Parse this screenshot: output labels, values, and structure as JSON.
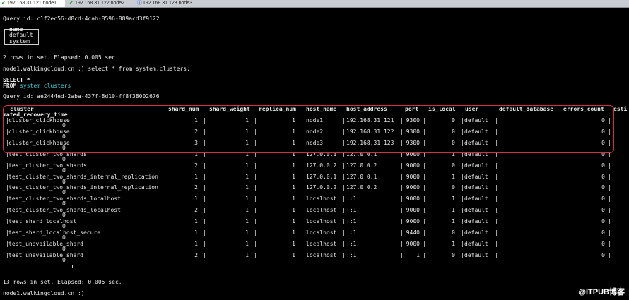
{
  "tabs": [
    {
      "label": "192.168.31.121 node1",
      "active": true
    },
    {
      "label": "192.168.31.122 node2",
      "active": false
    },
    {
      "label": "192.168.31.123 node3",
      "active": false
    }
  ],
  "top": {
    "query_id_1": "Query id: c1f2ec56-d8cd-4cab-8596-889acd3f9122",
    "name_header": "name",
    "name_rows": [
      "default",
      "system"
    ],
    "rows_info_1": "2 rows in set. Elapsed: 0.005 sec.",
    "prompt_1": "node1.walkingcloud.cn :) select * from system.clusters;",
    "select_kw": "SELECT *",
    "from_kw": "FROM",
    "from_table": "system.clusters",
    "query_id_2": "Query id: ae2444ed-2aba-437f-8d10-ff8f38002676"
  },
  "table": {
    "headers": [
      "cluster",
      "shard_num",
      "shard_weight",
      "replica_num",
      "host_name",
      "host_address",
      "port",
      "is_local",
      "user",
      "default_database",
      "errors_count",
      "esti"
    ],
    "wrap_header": "mated_recovery_time",
    "rows": [
      {
        "cluster": "cluster_clickhouse",
        "shard_num": "1",
        "shard_weight": "1",
        "replica_num": "1",
        "host_name": "node1",
        "host_address": "192.168.31.121",
        "port": "9300",
        "is_local": "0",
        "user": "default",
        "errors_count": "0",
        "wrap": "0"
      },
      {
        "cluster": "cluster_clickhouse",
        "shard_num": "2",
        "shard_weight": "1",
        "replica_num": "1",
        "host_name": "node2",
        "host_address": "192.168.31.122",
        "port": "9300",
        "is_local": "0",
        "user": "default",
        "errors_count": "0",
        "wrap": "0"
      },
      {
        "cluster": "cluster_clickhouse",
        "shard_num": "3",
        "shard_weight": "1",
        "replica_num": "1",
        "host_name": "node3",
        "host_address": "192.168.31.123",
        "port": "9300",
        "is_local": "0",
        "user": "default",
        "errors_count": "0",
        "wrap": "0"
      },
      {
        "cluster": "test_cluster_two_shards",
        "shard_num": "1",
        "shard_weight": "1",
        "replica_num": "1",
        "host_name": "127.0.0.1",
        "host_address": "127.0.0.1",
        "port": "9000",
        "is_local": "1",
        "user": "default",
        "errors_count": "0",
        "wrap": "0"
      },
      {
        "cluster": "test_cluster_two_shards",
        "shard_num": "2",
        "shard_weight": "1",
        "replica_num": "1",
        "host_name": "127.0.0.2",
        "host_address": "127.0.0.2",
        "port": "9000",
        "is_local": "0",
        "user": "default",
        "errors_count": "0",
        "wrap": "0"
      },
      {
        "cluster": "test_cluster_two_shards_internal_replication",
        "shard_num": "1",
        "shard_weight": "1",
        "replica_num": "1",
        "host_name": "127.0.0.1",
        "host_address": "127.0.0.1",
        "port": "9000",
        "is_local": "1",
        "user": "default",
        "errors_count": "0",
        "wrap": "0"
      },
      {
        "cluster": "test_cluster_two_shards_internal_replication",
        "shard_num": "2",
        "shard_weight": "1",
        "replica_num": "1",
        "host_name": "127.0.0.2",
        "host_address": "127.0.0.2",
        "port": "9000",
        "is_local": "0",
        "user": "default",
        "errors_count": "0",
        "wrap": "0"
      },
      {
        "cluster": "test_cluster_two_shards_localhost",
        "shard_num": "1",
        "shard_weight": "1",
        "replica_num": "1",
        "host_name": "localhost",
        "host_address": "::1",
        "port": "9000",
        "is_local": "1",
        "user": "default",
        "errors_count": "0",
        "wrap": "0"
      },
      {
        "cluster": "test_cluster_two_shards_localhost",
        "shard_num": "2",
        "shard_weight": "1",
        "replica_num": "1",
        "host_name": "localhost",
        "host_address": "::1",
        "port": "9000",
        "is_local": "1",
        "user": "default",
        "errors_count": "0",
        "wrap": "0"
      },
      {
        "cluster": "test_shard_localhost",
        "shard_num": "1",
        "shard_weight": "1",
        "replica_num": "1",
        "host_name": "localhost",
        "host_address": "::1",
        "port": "9000",
        "is_local": "1",
        "user": "default",
        "errors_count": "0",
        "wrap": "0"
      },
      {
        "cluster": "test_shard_localhost_secure",
        "shard_num": "1",
        "shard_weight": "1",
        "replica_num": "1",
        "host_name": "localhost",
        "host_address": "::1",
        "port": "9440",
        "is_local": "0",
        "user": "default",
        "errors_count": "0",
        "wrap": "0"
      },
      {
        "cluster": "test_unavailable_shard",
        "shard_num": "1",
        "shard_weight": "1",
        "replica_num": "1",
        "host_name": "localhost",
        "host_address": "::1",
        "port": "9000",
        "is_local": "1",
        "user": "default",
        "errors_count": "0",
        "wrap": "0"
      },
      {
        "cluster": "test_unavailable_shard",
        "shard_num": "2",
        "shard_weight": "1",
        "replica_num": "1",
        "host_name": "localhost",
        "host_address": "::1",
        "port": "1",
        "is_local": "0",
        "user": "default",
        "errors_count": "0",
        "wrap": "0"
      }
    ]
  },
  "bottom": {
    "rows_info_2": "13 rows in set. Elapsed: 0.005 sec.",
    "prompt_2": "node1.walkingcloud.cn :)"
  },
  "watermark": {
    "brand": "@ITPUB博客"
  }
}
